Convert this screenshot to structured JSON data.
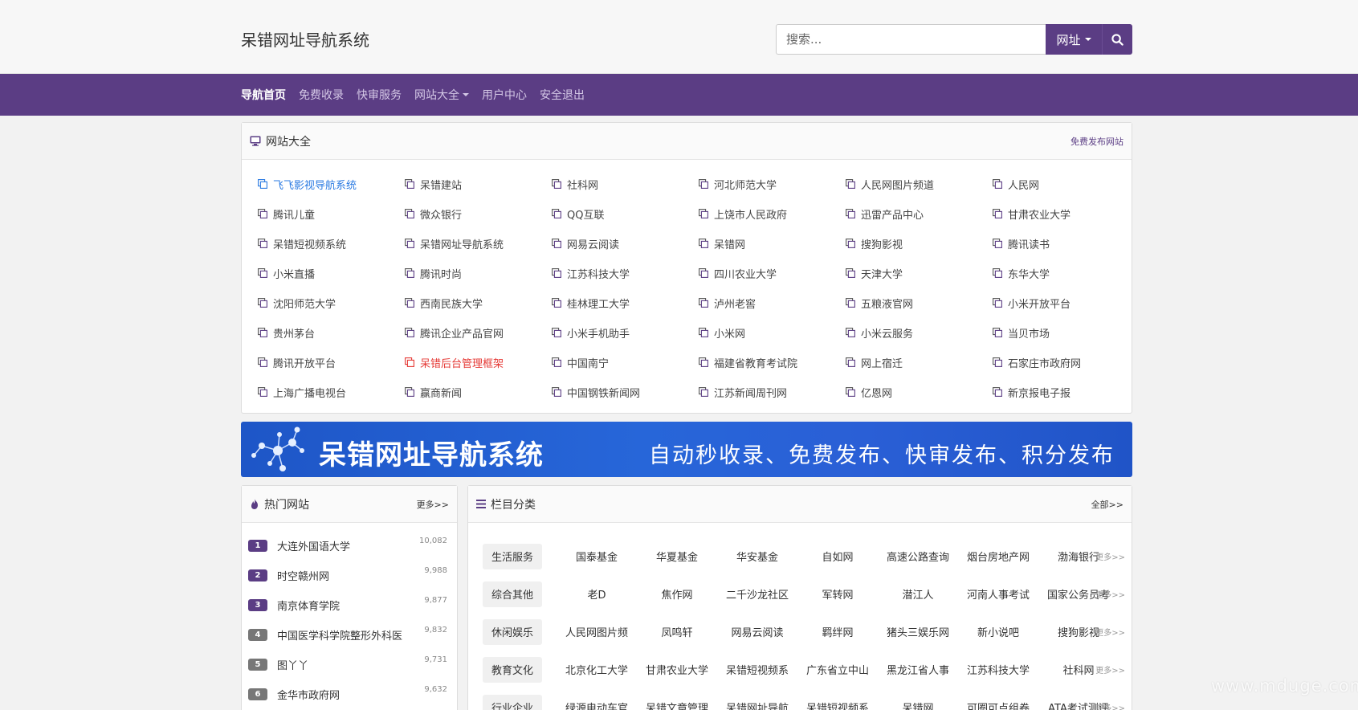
{
  "header": {
    "site_title": "呆错网址导航系统",
    "search_placeholder": "搜索...",
    "search_type": "网址"
  },
  "nav": [
    {
      "label": "导航首页",
      "active": true
    },
    {
      "label": "免费收录"
    },
    {
      "label": "快审服务"
    },
    {
      "label": "网站大全",
      "dropdown": true
    },
    {
      "label": "用户中心"
    },
    {
      "label": "安全退出"
    }
  ],
  "sites_panel": {
    "title": "网站大全",
    "more": "免费发布网站",
    "links": [
      {
        "label": "飞飞影视导航系统",
        "color": "#2a7ae2"
      },
      {
        "label": "呆错建站"
      },
      {
        "label": "社科网"
      },
      {
        "label": "河北师范大学"
      },
      {
        "label": "人民网图片频道"
      },
      {
        "label": "人民网"
      },
      {
        "label": "腾讯儿童"
      },
      {
        "label": "微众银行"
      },
      {
        "label": "QQ互联"
      },
      {
        "label": "上饶市人民政府"
      },
      {
        "label": "迅雷产品中心"
      },
      {
        "label": "甘肃农业大学"
      },
      {
        "label": "呆错短视频系统"
      },
      {
        "label": "呆错网址导航系统"
      },
      {
        "label": "网易云阅读"
      },
      {
        "label": "呆错网"
      },
      {
        "label": "搜狗影视"
      },
      {
        "label": "腾讯读书"
      },
      {
        "label": "小米直播"
      },
      {
        "label": "腾讯时尚"
      },
      {
        "label": "江苏科技大学"
      },
      {
        "label": "四川农业大学"
      },
      {
        "label": "天津大学"
      },
      {
        "label": "东华大学"
      },
      {
        "label": "沈阳师范大学"
      },
      {
        "label": "西南民族大学"
      },
      {
        "label": "桂林理工大学"
      },
      {
        "label": "泸州老窖"
      },
      {
        "label": "五粮液官网"
      },
      {
        "label": "小米开放平台"
      },
      {
        "label": "贵州茅台"
      },
      {
        "label": "腾讯企业产品官网"
      },
      {
        "label": "小米手机助手"
      },
      {
        "label": "小米网"
      },
      {
        "label": "小米云服务"
      },
      {
        "label": "当贝市场"
      },
      {
        "label": "腾讯开放平台"
      },
      {
        "label": "呆错后台管理框架",
        "color": "#e53935"
      },
      {
        "label": "中国南宁"
      },
      {
        "label": "福建省教育考试院"
      },
      {
        "label": "网上宿迁"
      },
      {
        "label": "石家庄市政府网"
      },
      {
        "label": "上海广播电视台"
      },
      {
        "label": "赢商新闻"
      },
      {
        "label": "中国钢铁新闻网"
      },
      {
        "label": "江苏新闻周刊网"
      },
      {
        "label": "亿恩网"
      },
      {
        "label": "新京报电子报"
      }
    ]
  },
  "banner": {
    "title": "呆错网址导航系统",
    "slogan": "自动秒收录、免费发布、快审发布、积分发布"
  },
  "hot_panel": {
    "title": "热门网站",
    "more": "更多>>",
    "items": [
      {
        "rank": "1",
        "name": "大连外国语大学",
        "count": "10,082",
        "color": "#5b3d84"
      },
      {
        "rank": "2",
        "name": "时空赣州网",
        "count": "9,988",
        "color": "#5b3d84"
      },
      {
        "rank": "3",
        "name": "南京体育学院",
        "count": "9,877",
        "color": "#5b3d84"
      },
      {
        "rank": "4",
        "name": "中国医学科学院整形外科医",
        "count": "9,832",
        "color": "#777777"
      },
      {
        "rank": "5",
        "name": "图丫丫",
        "count": "9,731",
        "color": "#777777"
      },
      {
        "rank": "6",
        "name": "金华市政府网",
        "count": "9,632",
        "color": "#777777"
      }
    ]
  },
  "category_panel": {
    "title": "栏目分类",
    "more": "全部>>",
    "rows": [
      {
        "tag": "生活服务",
        "links": [
          "国泰基金",
          "华夏基金",
          "华安基金",
          "自如网",
          "高速公路查询",
          "烟台房地产网",
          "渤海银行"
        ],
        "more": "更多>>"
      },
      {
        "tag": "综合其他",
        "links": [
          "老D",
          "焦作网",
          "二千沙龙社区",
          "军转网",
          "潜江人",
          "河南人事考试",
          "国家公务员考"
        ],
        "more": "更多>>"
      },
      {
        "tag": "休闲娱乐",
        "links": [
          "人民网图片频",
          "凤鸣轩",
          "网易云阅读",
          "羁绊网",
          "猪头三娱乐网",
          "新小说吧",
          "搜狗影视"
        ],
        "more": "更多>>"
      },
      {
        "tag": "教育文化",
        "links": [
          "北京化工大学",
          "甘肃农业大学",
          "呆错短视频系",
          "广东省立中山",
          "黑龙江省人事",
          "江苏科技大学",
          "社科网"
        ],
        "more": "更多>>"
      },
      {
        "tag": "行业企业",
        "links": [
          "绿源电动车官",
          "呆错文章管理",
          "呆错网址导航",
          "呆错短视频系",
          "呆错网",
          "可圈可点组卷",
          "ATA考试测评"
        ],
        "more": "更多>>"
      }
    ]
  },
  "watermark": "www.mduge.com",
  "colors": {
    "brand": "#5b3d84",
    "link_blue": "#2a7ae2",
    "link_red": "#e53935"
  }
}
